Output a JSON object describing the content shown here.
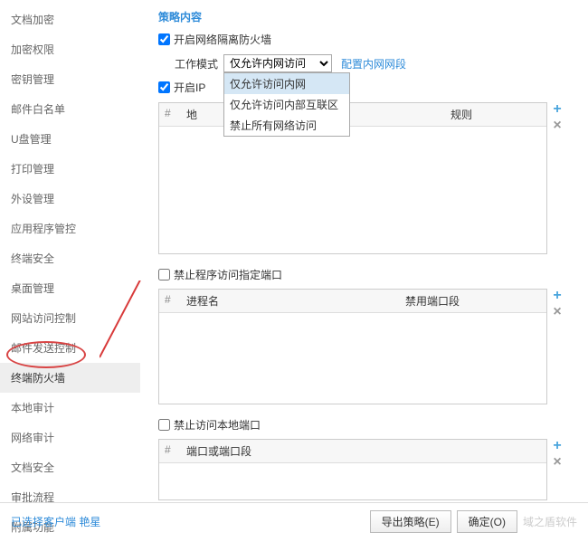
{
  "sidebar": {
    "items": [
      {
        "label": "文档加密"
      },
      {
        "label": "加密权限"
      },
      {
        "label": "密钥管理"
      },
      {
        "label": "邮件白名单"
      },
      {
        "label": "U盘管理"
      },
      {
        "label": "打印管理"
      },
      {
        "label": "外设管理"
      },
      {
        "label": "应用程序管控"
      },
      {
        "label": "终端安全"
      },
      {
        "label": "桌面管理"
      },
      {
        "label": "网站访问控制"
      },
      {
        "label": "邮件发送控制"
      },
      {
        "label": "终端防火墙"
      },
      {
        "label": "本地审计"
      },
      {
        "label": "网络审计"
      },
      {
        "label": "文档安全"
      },
      {
        "label": "审批流程"
      },
      {
        "label": "附属功能"
      }
    ],
    "active_index": 12
  },
  "main": {
    "section_title": "策略内容",
    "enable_firewall_label": "开启网络隔离防火墙",
    "enable_firewall_checked": true,
    "mode_label": "工作模式",
    "mode_selected": "仅允许内网访问",
    "mode_options": [
      "仅允许访问内网",
      "仅允许访问内部互联区",
      "禁止所有网络访问"
    ],
    "config_link": "配置内网网段",
    "enable_ip_label": "开启IP",
    "enable_ip_checked": true,
    "table1": {
      "col_num": "#",
      "col1": "地",
      "col2": "规则"
    },
    "block_process_label": "禁止程序访问指定端口",
    "block_process_checked": false,
    "table2": {
      "col_num": "#",
      "col1": "进程名",
      "col2": "禁用端口段"
    },
    "block_local_port_label": "禁止访问本地端口",
    "block_local_port_checked": false,
    "table3": {
      "col_num": "#",
      "col1": "端口或端口段"
    }
  },
  "footer": {
    "status": "已选择客户端 艳星",
    "export_label": "导出策略(E)",
    "ok_label": "确定(O)",
    "watermark": "域之盾软件"
  }
}
